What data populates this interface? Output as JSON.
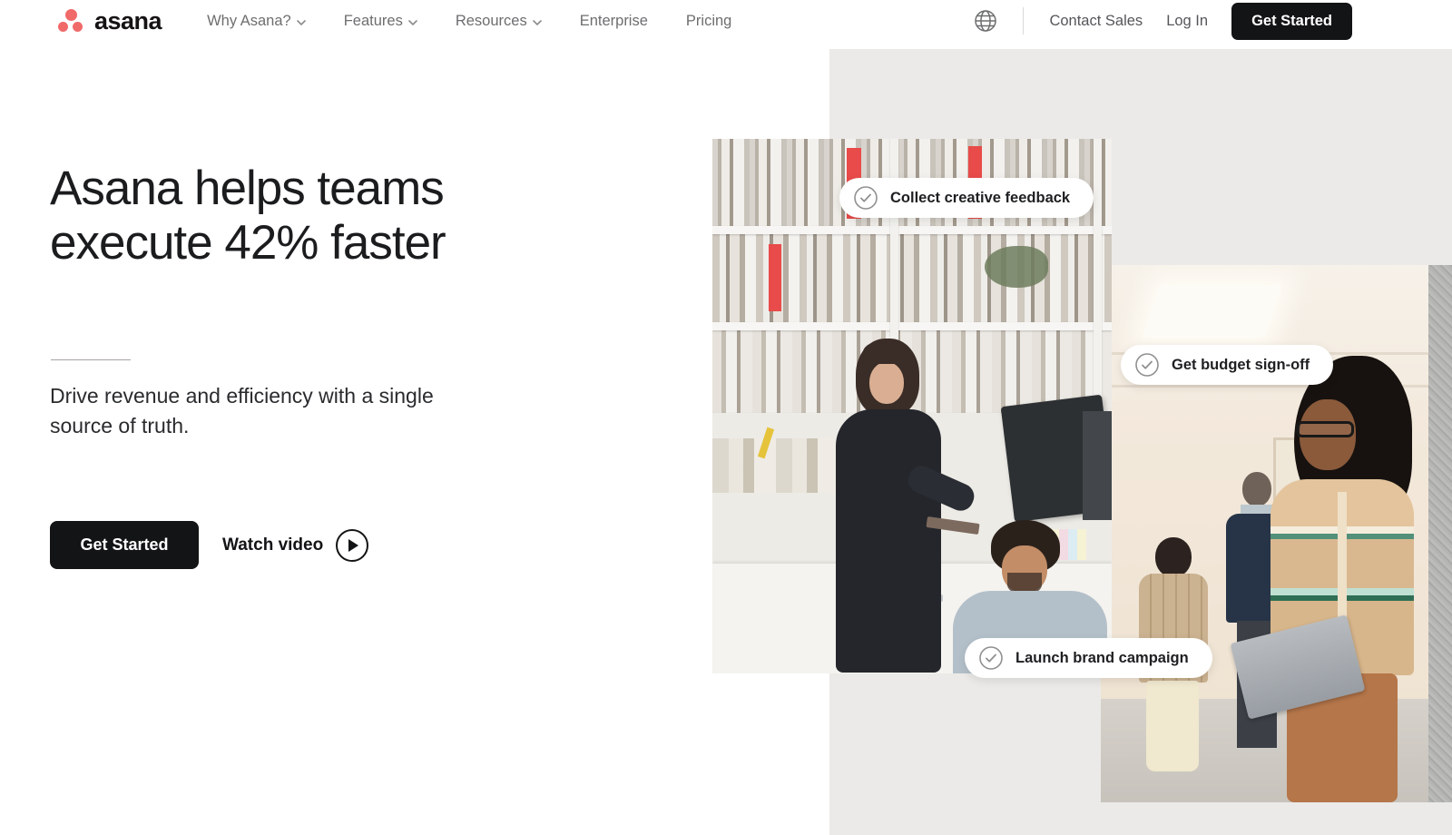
{
  "brand": {
    "name": "asana",
    "dot_color": "#f06a6a",
    "wordmark_color": "#161314"
  },
  "nav": {
    "items": [
      {
        "label": "Why Asana?",
        "has_dropdown": true
      },
      {
        "label": "Features",
        "has_dropdown": true
      },
      {
        "label": "Resources",
        "has_dropdown": true
      },
      {
        "label": "Enterprise",
        "has_dropdown": false
      },
      {
        "label": "Pricing",
        "has_dropdown": false
      }
    ],
    "contact_sales_label": "Contact Sales",
    "login_label": "Log In",
    "get_started_label": "Get Started"
  },
  "hero": {
    "heading_line1": "Asana helps teams",
    "heading_line2": "execute 42% faster",
    "subtext": "Drive revenue and efficiency with a single source of truth.",
    "get_started_label": "Get Started",
    "watch_video_label": "Watch video"
  },
  "badges": [
    {
      "label": "Collect creative feedback"
    },
    {
      "label": "Get budget sign-off"
    },
    {
      "label": "Launch brand campaign"
    }
  ],
  "icons": {
    "globe": "globe-icon",
    "chevron_down": "chevron-down-icon",
    "play": "play-circle-icon",
    "check": "check-circle-icon"
  },
  "colors": {
    "accent_coral": "#f06a6a",
    "button_black": "#131415",
    "nav_text_gray": "#6d6e6f",
    "gray_panel": "#ebeae8",
    "text_dark": "#1e1f21"
  }
}
